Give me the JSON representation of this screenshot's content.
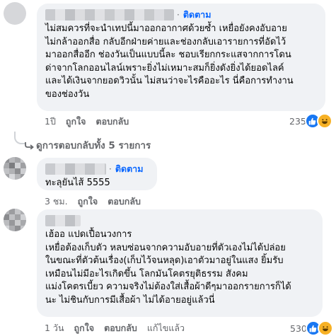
{
  "comments": [
    {
      "follow_label": "ติดตาม",
      "dot": "·",
      "text": "ไม่สมควรที่จะนำเทปนี้มาออกอากาศด้วยซ้ำ เหยื่อยังคงอับอาย\nไม่กล้าออกสื่อ กลับอีกฝ่ายค่ายและช่องกลับเอารายการที่อัดไว้\nมาออกสื่ออีก ช่องวันเป็นแบบนี้ละ ชอบเรียกกระแสจากการโดน\nด่าจากโลกออนไลน์เพราะยิ่งไม่เหมาะสมก็ยิ่งดังยิ่งได้ยอดไลค์\nและได้เงินจากยอดวิวนั้น ไม่สนว่าจะไรคืออะไร นี่คือการทำงาน\nของช่องวัน",
      "time": "1ปี",
      "like_label": "ถูกใจ",
      "reply_label": "ตอบกลับ",
      "reaction_count": "235",
      "reactions": [
        "like-icon",
        "haha-icon"
      ]
    },
    {
      "follow_label": "ติดตาม",
      "dot": "·",
      "text": "ทะลุยันไส้ 5555",
      "time": "3 ชม.",
      "like_label": "ถูกใจ",
      "reply_label": "ตอบกลับ",
      "reaction_count": "",
      "reactions": []
    },
    {
      "follow_label": "",
      "dot": "",
      "text": "เฮ้ออ แปดเปื้อนวงการ\nเหยื่อต้องเก็บตัว หลบซ่อนจากความอับอายที่ตัวเองไม่ได้ปล่อย\nในขณะที่ตัวต้นเรื่อง(เก็บไว้จนหลุด)เอาตัวมาอยู่ในแสง ยิ้มรับ\nเหมือนไม่มีอะไรเกิดขึ้น โลกมันโคตรยุติธรรม สังคม\nแม่งโคตรเบี้ยว ความจริงไม่ต้องใส่เสื้อผ้าดีๆมาออกรายการก็ได้\nนะ ไม่ชินกับการมีเสื้อผ้า ไม่ได้อายอยู่แล้วนี่",
      "time": "1 วัน",
      "like_label": "ถูกใจ",
      "reply_label": "ตอบกลับ",
      "edited_label": "แก้ไขแล้ว",
      "reaction_count": "530",
      "reactions": [
        "like-icon",
        "haha-icon"
      ]
    }
  ],
  "view_replies": "ดูการตอบกลับทั้ง 5 รายการ",
  "colors": {
    "accent": "#0866ff",
    "bubble": "#f0f2f5",
    "muted": "#65676b",
    "like": "#1877f2",
    "haha": "#f7b125"
  }
}
